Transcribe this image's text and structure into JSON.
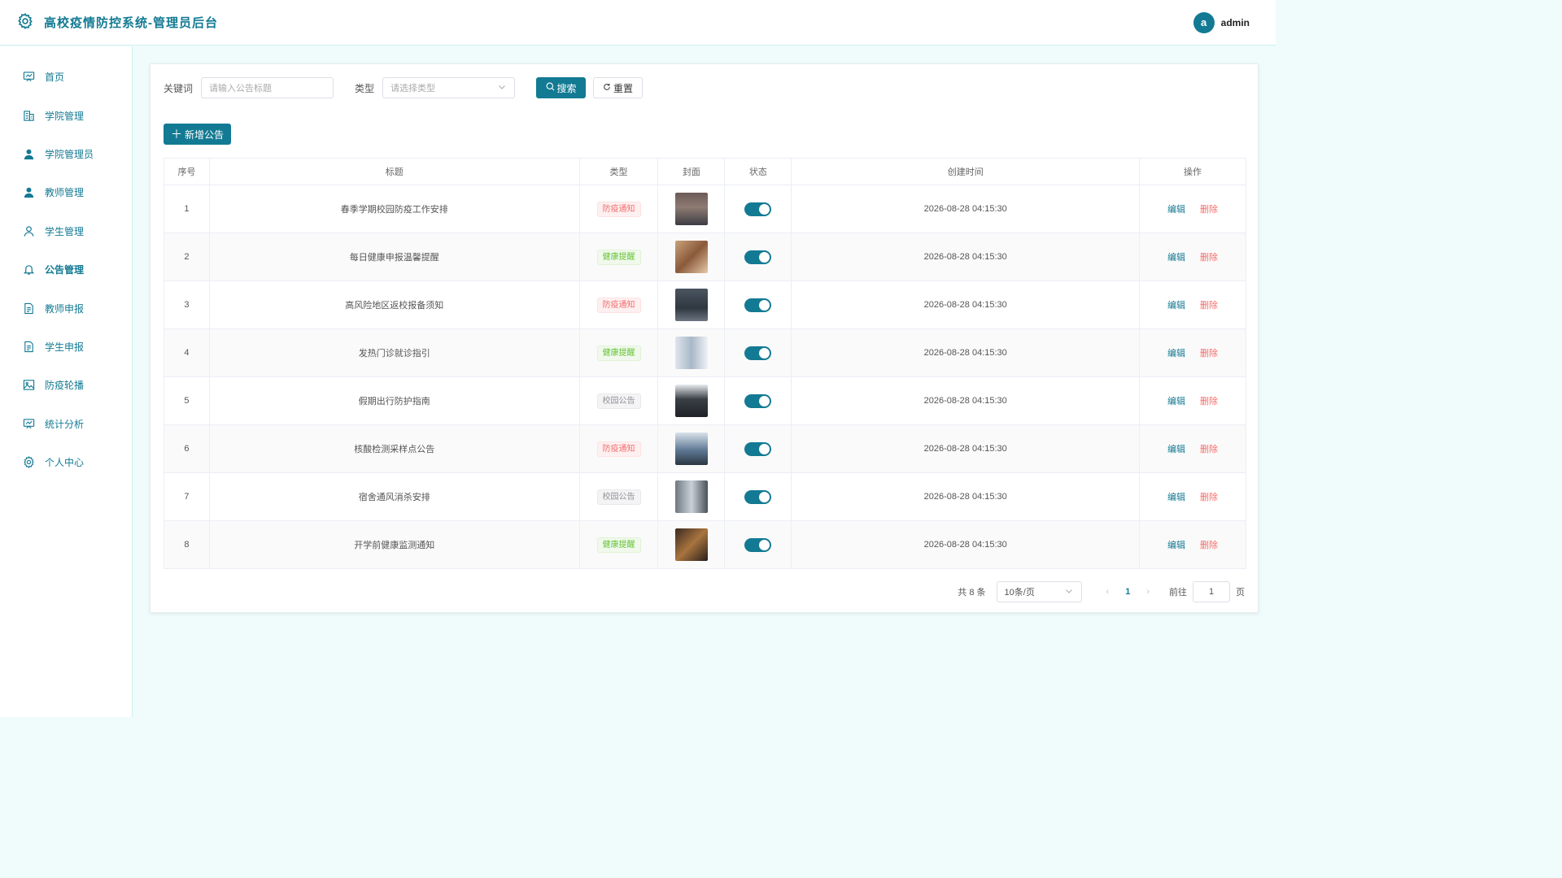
{
  "header": {
    "title": "高校疫情防控系统-管理员后台",
    "user_initial": "a",
    "username": "admin"
  },
  "sidebar": {
    "items": [
      {
        "label": "首页",
        "icon": "presentation-board-icon"
      },
      {
        "label": "学院管理",
        "icon": "building-icon"
      },
      {
        "label": "学院管理员",
        "icon": "user-filled-icon"
      },
      {
        "label": "教师管理",
        "icon": "user-filled-icon"
      },
      {
        "label": "学生管理",
        "icon": "user-outline-icon"
      },
      {
        "label": "公告管理",
        "icon": "bell-icon"
      },
      {
        "label": "教师申报",
        "icon": "document-icon"
      },
      {
        "label": "学生申报",
        "icon": "document-icon"
      },
      {
        "label": "防疫轮播",
        "icon": "picture-icon"
      },
      {
        "label": "统计分析",
        "icon": "presentation-board-icon"
      },
      {
        "label": "个人中心",
        "icon": "gear-icon"
      }
    ],
    "active": "公告管理"
  },
  "search": {
    "keyword_label": "关键词",
    "keyword_placeholder": "请输入公告标题",
    "type_label": "类型",
    "type_placeholder": "请选择类型",
    "search_btn": "搜索",
    "reset_btn": "重置"
  },
  "toolbar": {
    "add_btn": "新增公告"
  },
  "table": {
    "columns": [
      "序号",
      "标题",
      "类型",
      "封面",
      "状态",
      "创建时间",
      "操作"
    ],
    "edit_label": "编辑",
    "delete_label": "删除",
    "rows": [
      {
        "no": "1",
        "title": "春季学期校园防疫工作安排",
        "type": "防疫通知",
        "tag": "red",
        "status": true,
        "time": "2026-08-28 04:15:30"
      },
      {
        "no": "2",
        "title": "每日健康申报温馨提醒",
        "type": "健康提醒",
        "tag": "green",
        "status": true,
        "time": "2026-08-28 04:15:30"
      },
      {
        "no": "3",
        "title": "高风险地区返校报备须知",
        "type": "防疫通知",
        "tag": "red",
        "status": true,
        "time": "2026-08-28 04:15:30"
      },
      {
        "no": "4",
        "title": "发热门诊就诊指引",
        "type": "健康提醒",
        "tag": "green",
        "status": true,
        "time": "2026-08-28 04:15:30"
      },
      {
        "no": "5",
        "title": "假期出行防护指南",
        "type": "校园公告",
        "tag": "gray",
        "status": true,
        "time": "2026-08-28 04:15:30"
      },
      {
        "no": "6",
        "title": "核酸检测采样点公告",
        "type": "防疫通知",
        "tag": "red",
        "status": true,
        "time": "2026-08-28 04:15:30"
      },
      {
        "no": "7",
        "title": "宿舍通风消杀安排",
        "type": "校园公告",
        "tag": "gray",
        "status": true,
        "time": "2026-08-28 04:15:30"
      },
      {
        "no": "8",
        "title": "开学前健康监测通知",
        "type": "健康提醒",
        "tag": "green",
        "status": true,
        "time": "2026-08-28 04:15:30"
      }
    ]
  },
  "pagination": {
    "total_text": "共 8 条",
    "page_size": "10条/页",
    "current_page": "1",
    "goto_label": "前往",
    "goto_value": "1",
    "page_suffix": "页"
  },
  "colors": {
    "primary": "#137a93",
    "danger": "#f56c6c",
    "success": "#67c23a",
    "info": "#909399"
  }
}
